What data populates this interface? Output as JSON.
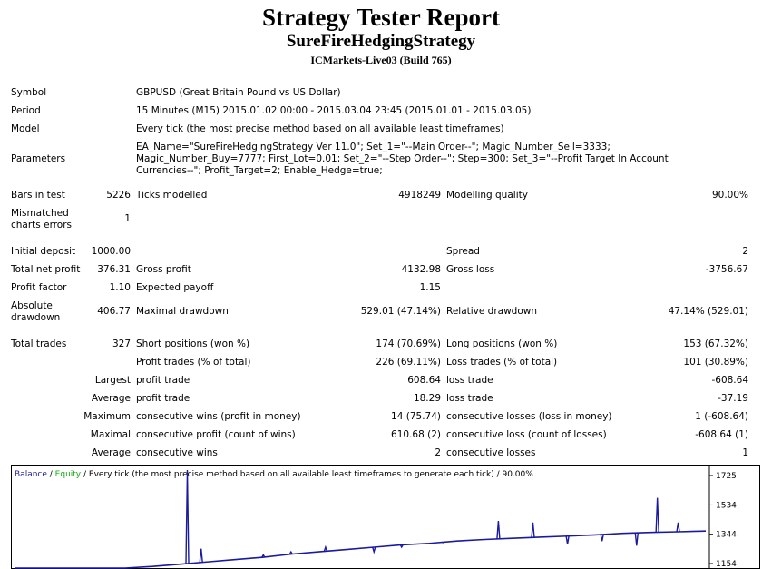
{
  "header": {
    "title": "Strategy Tester Report",
    "strategy": "SureFireHedgingStrategy",
    "server": "ICMarkets-Live03 (Build 765)"
  },
  "info": {
    "symbol_label": "Symbol",
    "symbol_value": "GBPUSD (Great Britain Pound vs US Dollar)",
    "period_label": "Period",
    "period_value": "15 Minutes (M15) 2015.01.02 00:00 - 2015.03.04 23:45 (2015.01.01 - 2015.03.05)",
    "model_label": "Model",
    "model_value": "Every tick (the most precise method based on all available least timeframes)",
    "parameters_label": "Parameters",
    "parameters_value": "EA_Name=\"SureFireHedgingStrategy Ver 11.0\"; Set_1=\"--Main Order--\"; Magic_Number_Sell=3333; Magic_Number_Buy=7777; First_Lot=0.01; Set_2=\"--Step Order--\"; Step=300; Set_3=\"--Profit Target In Account Currencies--\"; Profit_Target=2; Enable_Hedge=true;"
  },
  "stats": {
    "bars_label": "Bars in test",
    "bars_value": "5226",
    "ticks_label": "Ticks modelled",
    "ticks_value": "4918249",
    "quality_label": "Modelling quality",
    "quality_value": "90.00%",
    "mismatch_label_1": "Mismatched",
    "mismatch_label_2": "charts errors",
    "mismatch_value": "1",
    "deposit_label": "Initial deposit",
    "deposit_value": "1000.00",
    "spread_label": "Spread",
    "spread_value": "2",
    "net_label": "Total net profit",
    "net_value": "376.31",
    "gross_profit_label": "Gross profit",
    "gross_profit_value": "4132.98",
    "gross_loss_label": "Gross loss",
    "gross_loss_value": "-3756.67",
    "pf_label": "Profit factor",
    "pf_value": "1.10",
    "ep_label": "Expected payoff",
    "ep_value": "1.15",
    "abs_dd_label_1": "Absolute",
    "abs_dd_label_2": "drawdown",
    "abs_dd_value": "406.77",
    "max_dd_label": "Maximal drawdown",
    "max_dd_value": "529.01 (47.14%)",
    "rel_dd_label": "Relative drawdown",
    "rel_dd_value": "47.14% (529.01)",
    "trades_label": "Total trades",
    "trades_value": "327",
    "short_label": "Short positions (won %)",
    "short_value": "174 (70.69%)",
    "long_label": "Long positions (won %)",
    "long_value": "153 (67.32%)",
    "pt_label": "Profit trades (% of total)",
    "pt_value": "226 (69.11%)",
    "lt_label": "Loss trades (% of total)",
    "lt_value": "101 (30.89%)",
    "largest_label": "Largest",
    "largest_profit_label": "profit trade",
    "largest_profit_value": "608.64",
    "largest_loss_label": "loss trade",
    "largest_loss_value": "-608.64",
    "average_label": "Average",
    "average_profit_label": "profit trade",
    "average_profit_value": "18.29",
    "average_loss_label": "loss trade",
    "average_loss_value": "-37.19",
    "maximum_label": "Maximum",
    "max_wins_label": "consecutive wins (profit in money)",
    "max_wins_value": "14 (75.74)",
    "max_losses_label": "consecutive losses (loss in money)",
    "max_losses_value": "1 (-608.64)",
    "maximal_label": "Maximal",
    "maximal_profit_label": "consecutive profit (count of wins)",
    "maximal_profit_value": "610.68 (2)",
    "maximal_loss_label": "consecutive loss (count of losses)",
    "maximal_loss_value": "-608.64 (1)",
    "avg2_label": "Average",
    "avg_wins_label": "consecutive wins",
    "avg_wins_value": "2",
    "avg_losses_label": "consecutive losses",
    "avg_losses_value": "1"
  },
  "chart_data": {
    "type": "line",
    "legend": {
      "balance": "Balance",
      "sep1": " / ",
      "equity": "Equity",
      "rest": " / Every tick (the most precise method based on all available least timeframes to generate each tick) / 90.00%"
    },
    "y_ticks": [
      1725,
      1534,
      1344,
      1154
    ],
    "ylim": [
      1154,
      1725
    ],
    "colors": {
      "balance": "#1a1aa0",
      "equity": "#11aa11",
      "axis": "#000000"
    },
    "series": [
      {
        "name": "Balance",
        "x": [
          0,
          0.04,
          0.08,
          0.12,
          0.16,
          0.2,
          0.24,
          0.28,
          0.32,
          0.36,
          0.4,
          0.44,
          0.48,
          0.52,
          0.56,
          0.6,
          0.64,
          0.68,
          0.72,
          0.76,
          0.8,
          0.84,
          0.88,
          0.92,
          0.96,
          1.0
        ],
        "values": [
          1000,
          1050,
          1075,
          1100,
          1120,
          1135,
          1150,
          1165,
          1180,
          1195,
          1215,
          1230,
          1245,
          1260,
          1275,
          1285,
          1300,
          1310,
          1318,
          1325,
          1332,
          1340,
          1350,
          1356,
          1360,
          1365
        ]
      },
      {
        "name": "Equity spikes",
        "x": [
          0.25,
          0.27,
          0.36,
          0.4,
          0.45,
          0.52,
          0.56,
          0.62,
          0.7,
          0.75,
          0.8,
          0.85,
          0.9,
          0.93,
          0.96
        ],
        "values": [
          1760,
          1250,
          1210,
          1230,
          1260,
          1230,
          1260,
          1290,
          1430,
          1420,
          1280,
          1300,
          1270,
          1580,
          1420
        ]
      }
    ]
  }
}
